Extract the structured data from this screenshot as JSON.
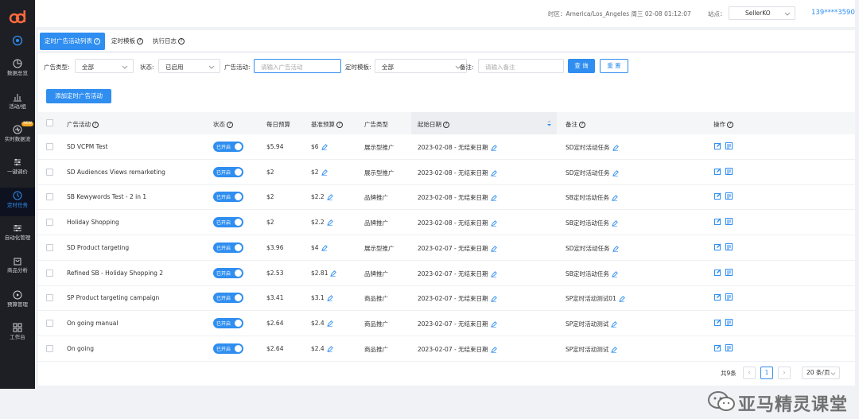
{
  "sidebar": {
    "items": [
      {
        "label": "数据总览",
        "icon": "pie-chart-icon"
      },
      {
        "label": "活动/组",
        "icon": "bar-chart-icon"
      },
      {
        "label": "实时数据流",
        "icon": "stream-icon",
        "badge": "NEW"
      },
      {
        "label": "一键调价",
        "icon": "adjust-icon"
      },
      {
        "label": "定时任务",
        "icon": "clock-icon"
      },
      {
        "label": "自动化管理",
        "icon": "sliders-icon"
      },
      {
        "label": "商品分析",
        "icon": "bag-icon"
      },
      {
        "label": "预算管理",
        "icon": "play-icon"
      },
      {
        "label": "工作台",
        "icon": "grid-icon"
      }
    ],
    "active_index": 4
  },
  "topbar": {
    "timezone": "时区：America/Los_Angeles 周三 02-08 01:12:07",
    "site_label": "站点：",
    "site_value": "SellerKO",
    "phone": "139****3590"
  },
  "tabs": [
    {
      "label": "定时广告活动列表"
    },
    {
      "label": "定时模板"
    },
    {
      "label": "执行日志"
    }
  ],
  "filters": {
    "ad_type_label": "广告类型:",
    "ad_type_value": "全部",
    "status_label": "状态:",
    "status_value": "已启用",
    "campaign_label": "广告活动:",
    "campaign_placeholder": "请输入广告活动",
    "template_label": "定时模板:",
    "template_value": "全部",
    "note_label": "备注:",
    "note_placeholder": "请输入备注",
    "query_label": "查 询",
    "reset_label": "重 置"
  },
  "add_button": "添加定时广告活动",
  "table": {
    "headers": {
      "campaign": "广告活动",
      "status": "状态",
      "daily_budget": "每日预算",
      "base_budget": "基准预算",
      "ad_type": "广告类型",
      "start_date": "起始日期",
      "note": "备注",
      "action": "操作"
    },
    "status_on": "已开启",
    "rows": [
      {
        "campaign": "SD VCPM Test",
        "daily": "$5.94",
        "base": "$6",
        "type": "展示型推广",
        "date": "2023-02-08 - 无结束日期",
        "note": "SD定时活动任务"
      },
      {
        "campaign": "SD Audiences Views remarketing",
        "daily": "$2",
        "base": "$2",
        "type": "展示型推广",
        "date": "2023-02-08 - 无结束日期",
        "note": "SD定时活动任务"
      },
      {
        "campaign": "SB Kewywords Test - 2 in 1",
        "daily": "$2",
        "base": "$2.2",
        "type": "品牌推广",
        "date": "2023-02-08 - 无结束日期",
        "note": "SB定时活动任务"
      },
      {
        "campaign": "Holiday Shopping",
        "daily": "$2",
        "base": "$2.2",
        "type": "品牌推广",
        "date": "2023-02-08 - 无结束日期",
        "note": "SB定时活动任务"
      },
      {
        "campaign": "SD Product targeting",
        "daily": "$3.96",
        "base": "$4",
        "type": "展示型推广",
        "date": "2023-02-07 - 无结束日期",
        "note": "SD定时活动任务"
      },
      {
        "campaign": "Refined SB - Holiday Shopping 2",
        "daily": "$2.53",
        "base": "$2.81",
        "type": "品牌推广",
        "date": "2023-02-07 - 无结束日期",
        "note": "SB定时活动任务"
      },
      {
        "campaign": "SP Product targeting campaign",
        "daily": "$3.41",
        "base": "$3.1",
        "type": "商品推广",
        "date": "2023-02-07 - 无结束日期",
        "note": "SP定时活动测试01"
      },
      {
        "campaign": "On going manual",
        "daily": "$2.64",
        "base": "$2.4",
        "type": "商品推广",
        "date": "2023-02-07 - 无结束日期",
        "note": "SP定时活动测试"
      },
      {
        "campaign": "On going",
        "daily": "$2.64",
        "base": "$2.4",
        "type": "商品推广",
        "date": "2023-02-07 - 无结束日期",
        "note": "SP定时活动测试"
      }
    ]
  },
  "pagination": {
    "total": "共9条",
    "current": "1",
    "page_size": "20 条/页"
  },
  "watermark": "亚马精灵课堂",
  "colors": {
    "accent": "#2f8ef0",
    "sidebar": "#1e1f24"
  }
}
